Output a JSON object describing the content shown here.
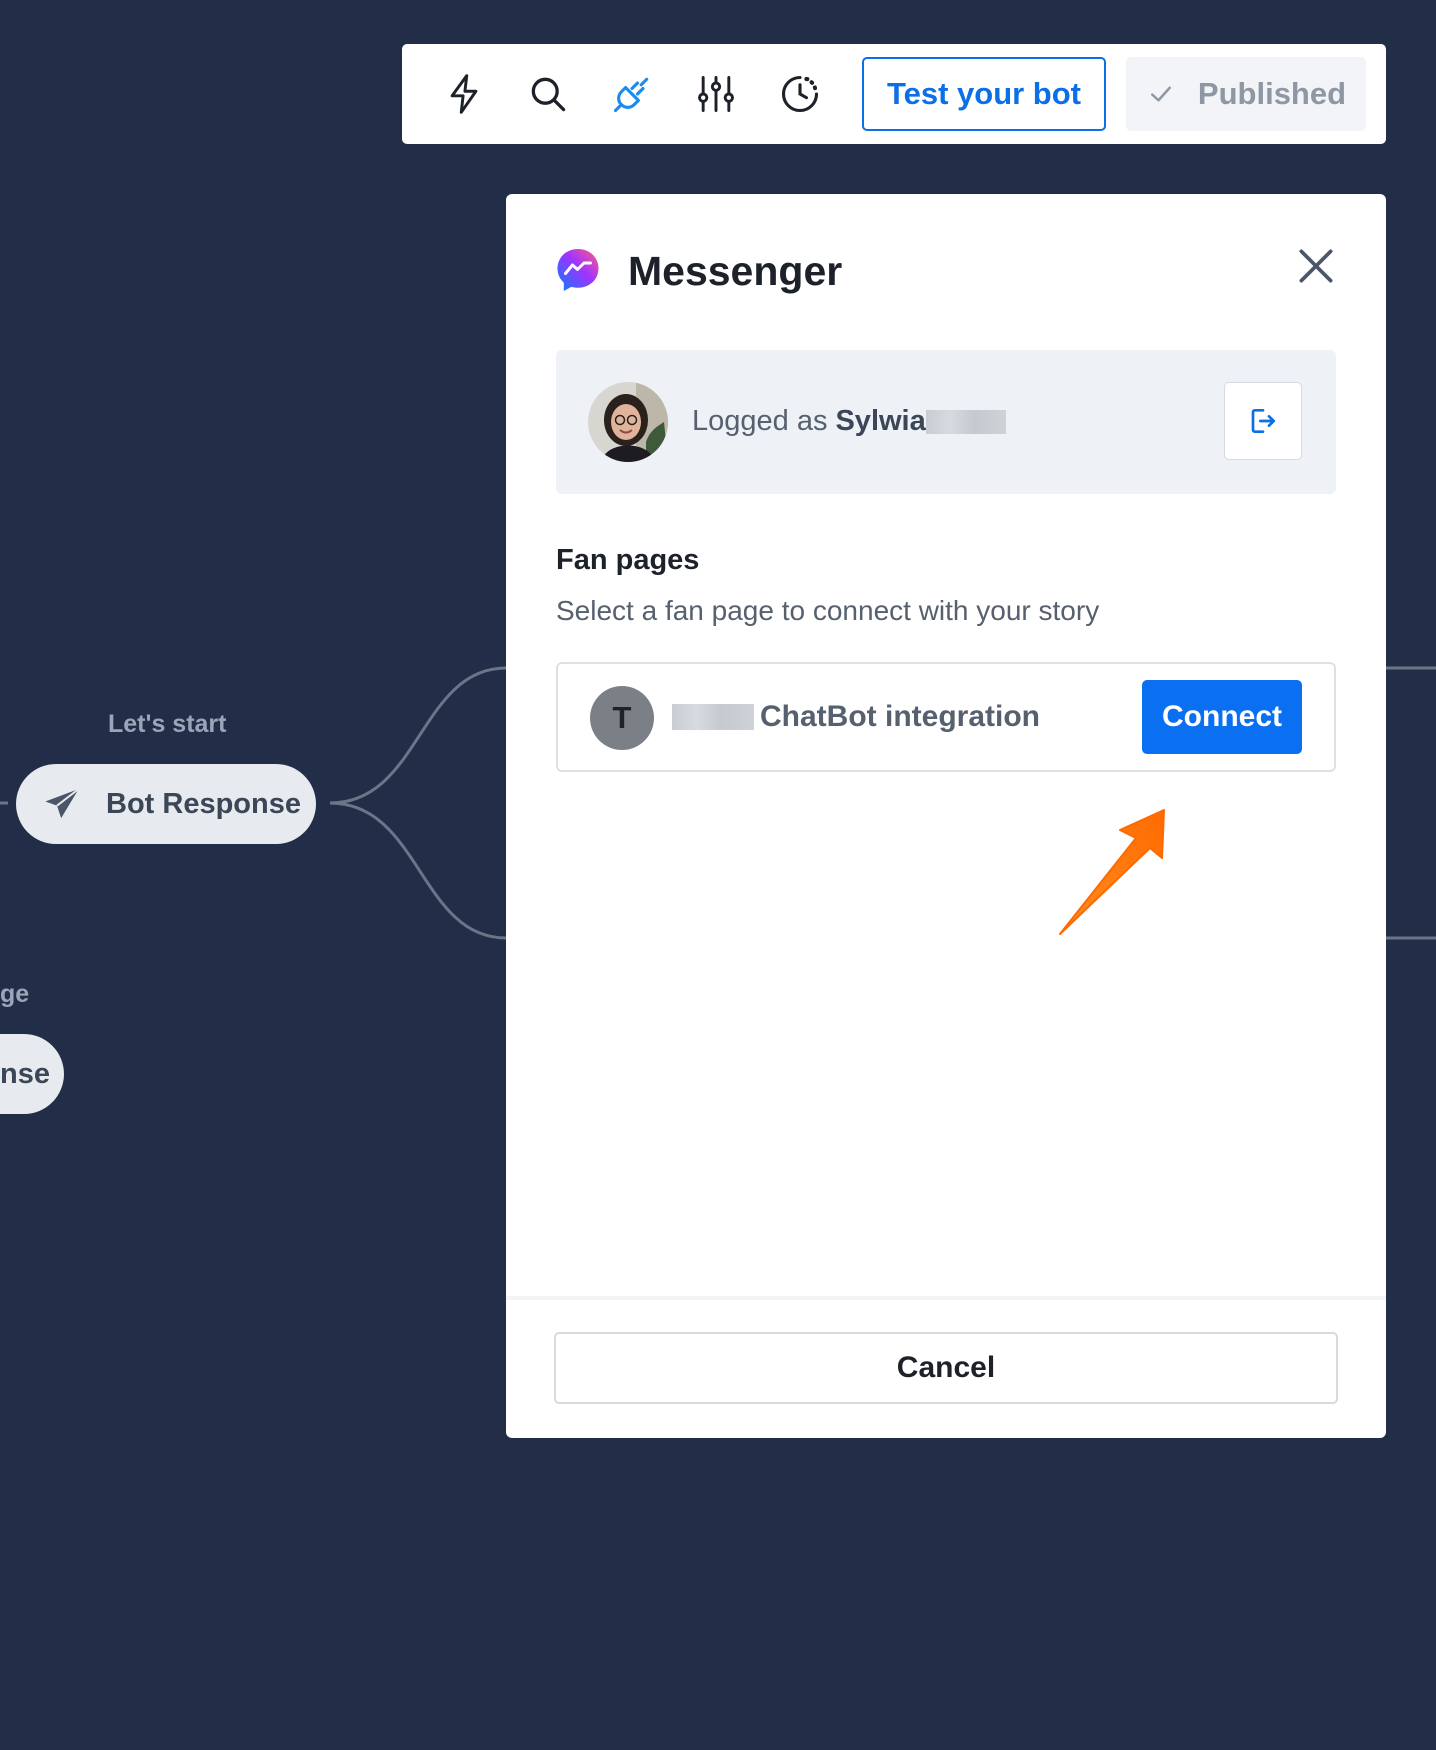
{
  "toolbar": {
    "icons": [
      "lightning-icon",
      "search-icon",
      "plug-icon",
      "sliders-icon",
      "history-icon"
    ],
    "test_label": "Test your bot",
    "published_label": "Published"
  },
  "canvas": {
    "node1_label": "Let's start",
    "node1_text": "Bot Response",
    "node2_label": "ge",
    "node2_text": "nse"
  },
  "modal": {
    "title": "Messenger",
    "logged_prefix": "Logged as",
    "user_name": "Sylwia",
    "section_title": "Fan pages",
    "section_subtitle": "Select a fan page to connect with your story",
    "page_initial": "T",
    "page_name": "ChatBot integration",
    "connect_label": "Connect",
    "cancel_label": "Cancel"
  },
  "colors": {
    "background": "#222e48",
    "accent": "#0b6ff2",
    "annotation_arrow": "#ff7a12"
  }
}
